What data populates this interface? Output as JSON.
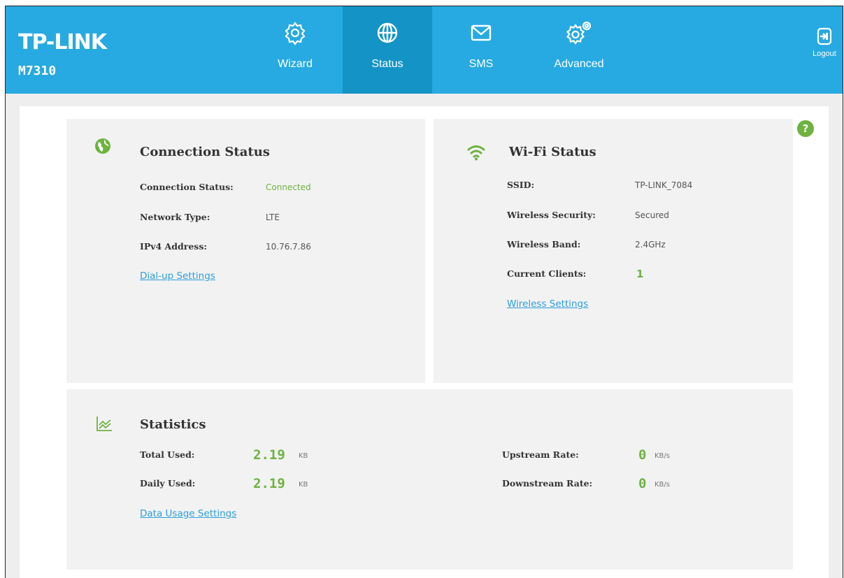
{
  "brand": {
    "logo": "TP-LINK",
    "model": "M7310"
  },
  "nav": {
    "items": [
      {
        "label": "Wizard",
        "icon": "gear-icon"
      },
      {
        "label": "Status",
        "icon": "globe-icon",
        "active": true
      },
      {
        "label": "SMS",
        "icon": "envelope-icon"
      },
      {
        "label": "Advanced",
        "icon": "gears-icon"
      }
    ],
    "logout_label": "Logout"
  },
  "colors": {
    "header": "#27aae1",
    "active_tab": "#1493c6",
    "accent_green": "#6db33f",
    "link": "#2d9fd8"
  },
  "help_label": "?",
  "connection": {
    "title": "Connection Status",
    "rows": [
      {
        "label": "Connection Status:",
        "value": "Connected"
      },
      {
        "label": "Network Type:",
        "value": "LTE"
      },
      {
        "label": "IPv4 Address:",
        "value": "10.76.7.86"
      }
    ],
    "link": "Dial-up Settings"
  },
  "wifi": {
    "title": "Wi-Fi Status",
    "rows": [
      {
        "label": "SSID:",
        "value": "TP-LINK_7084"
      },
      {
        "label": "Wireless Security:",
        "value": "Secured"
      },
      {
        "label": "Wireless Band:",
        "value": "2.4GHz"
      },
      {
        "label": "Current Clients:",
        "value": "1"
      }
    ],
    "link": "Wireless Settings"
  },
  "stats": {
    "title": "Statistics",
    "total_used": {
      "label": "Total Used:",
      "value": "2.19",
      "unit": "KB"
    },
    "daily_used": {
      "label": "Daily Used:",
      "value": "2.19",
      "unit": "KB"
    },
    "upstream": {
      "label": "Upstream Rate:",
      "value": "0",
      "unit": "KB/s"
    },
    "downstream": {
      "label": "Downstream Rate:",
      "value": "0",
      "unit": "KB/s"
    },
    "link": "Data Usage Settings"
  }
}
